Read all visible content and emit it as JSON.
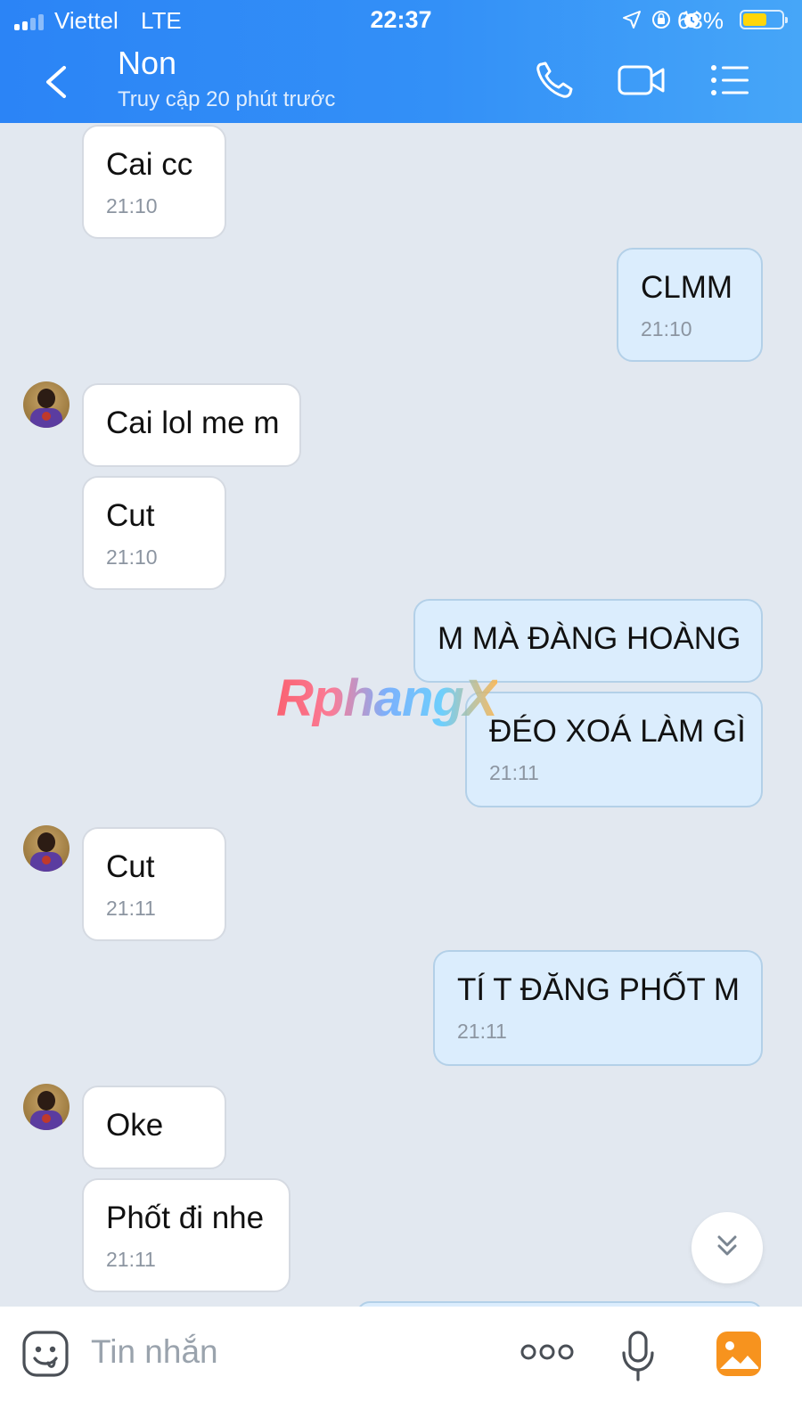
{
  "status_bar": {
    "carrier": "Viettel",
    "network": "LTE",
    "time": "22:37",
    "battery_percent": "63%",
    "battery_level": 0.63
  },
  "header": {
    "title": "Non",
    "subtitle": "Truy cập 20 phút trước"
  },
  "messages": [
    {
      "side": "in",
      "text": "Cai cc",
      "time": "21:10"
    },
    {
      "side": "out",
      "text": "CLMM",
      "time": "21:10"
    },
    {
      "side": "in",
      "text": "Cai lol me m",
      "time": ""
    },
    {
      "side": "in",
      "text": "Cut",
      "time": "21:10"
    },
    {
      "side": "out",
      "text": "M MÀ ĐÀNG HOÀNG",
      "time": ""
    },
    {
      "side": "out",
      "text": "ĐÉO XOÁ LÀM GÌ",
      "time": "21:11"
    },
    {
      "side": "in",
      "text": "Cut",
      "time": "21:11"
    },
    {
      "side": "out",
      "text": "TÍ T ĐĂNG PHỐT M",
      "time": "21:11"
    },
    {
      "side": "in",
      "text": "Oke",
      "time": ""
    },
    {
      "side": "in",
      "text": "Phốt đi nhe",
      "time": "21:11"
    }
  ],
  "watermark": "RphangX",
  "input": {
    "placeholder": "Tin nhắn"
  },
  "icons": {
    "back": "chevron-left-icon",
    "call": "phone-icon",
    "video": "video-camera-icon",
    "menu": "list-menu-icon",
    "scroll": "double-chevron-down-icon",
    "sticker": "sticker-icon",
    "more": "more-dots-icon",
    "mic": "microphone-icon",
    "photo": "photo-icon"
  },
  "colors": {
    "header": "#3390f7",
    "incoming_bubble": "#ffffff",
    "outgoing_bubble": "#dbedfd",
    "chat_background": "#e2e8f0",
    "photo_icon": "#f7931e"
  }
}
